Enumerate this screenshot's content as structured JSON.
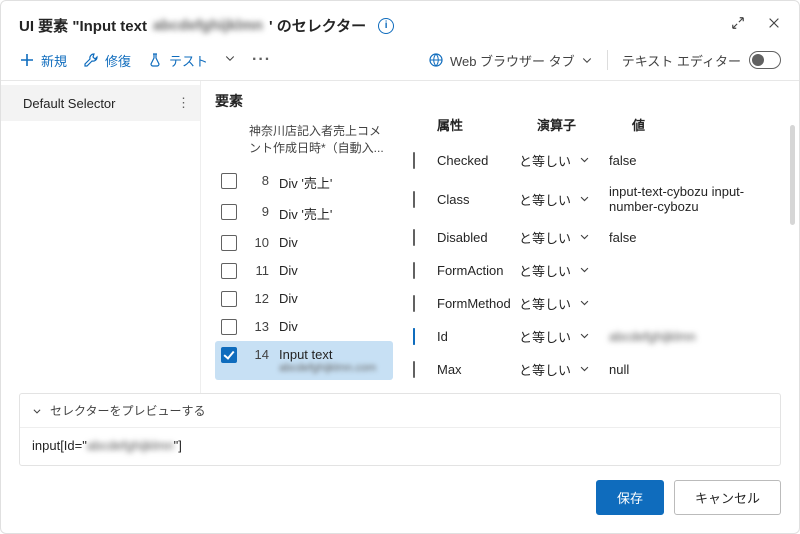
{
  "title": {
    "prefix": "UI 要素 \"Input text",
    "redacted": "abcdefghijklmn",
    "suffix": "' のセレクター"
  },
  "toolbar": {
    "new": "新規",
    "repair": "修復",
    "test": "テスト",
    "browser_tab": "Web ブラウザー タブ",
    "text_editor": "テキスト エディター"
  },
  "side": {
    "default_selector": "Default Selector"
  },
  "mid": {
    "heading": "要素",
    "path": "神奈川店記入者売上コメント作成日時*（自動入...",
    "rows": [
      {
        "n": "8",
        "label": "Div '売上'",
        "checked": false,
        "selected": false
      },
      {
        "n": "9",
        "label": "Div '売上'",
        "checked": false,
        "selected": false
      },
      {
        "n": "10",
        "label": "Div",
        "checked": false,
        "selected": false
      },
      {
        "n": "11",
        "label": "Div",
        "checked": false,
        "selected": false
      },
      {
        "n": "12",
        "label": "Div",
        "checked": false,
        "selected": false
      },
      {
        "n": "13",
        "label": "Div",
        "checked": false,
        "selected": false
      },
      {
        "n": "14",
        "label": "Input text",
        "checked": true,
        "selected": true,
        "sub": "abcdefghijklmn.com"
      }
    ]
  },
  "right": {
    "col_attr": "属性",
    "col_op": "演算子",
    "col_val": "値",
    "op_equal": "と等しい",
    "rows": [
      {
        "checked": false,
        "attr": "Checked",
        "val": "false"
      },
      {
        "checked": false,
        "attr": "Class",
        "val": "input-text-cybozu input-number-cybozu"
      },
      {
        "checked": false,
        "attr": "Disabled",
        "val": "false"
      },
      {
        "checked": false,
        "attr": "FormAction",
        "val": ""
      },
      {
        "checked": false,
        "attr": "FormMethod",
        "val": ""
      },
      {
        "checked": true,
        "attr": "Id",
        "val": "abcdefghijklmn",
        "blur": true
      },
      {
        "checked": false,
        "attr": "Max",
        "val": "null"
      }
    ]
  },
  "preview": {
    "label": "セレクターをプレビューする",
    "prefix": "input[Id=\"",
    "redacted": "abcdefghijklmn",
    "suffix": "\"]"
  },
  "footer": {
    "save": "保存",
    "cancel": "キャンセル"
  }
}
